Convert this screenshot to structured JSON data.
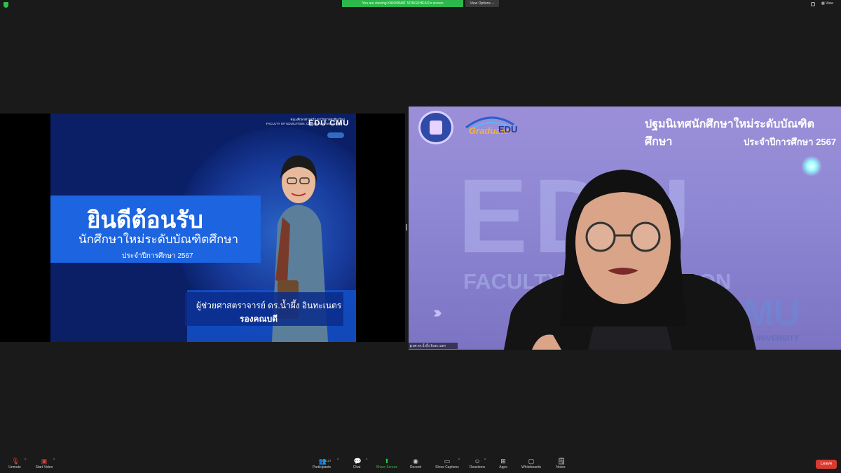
{
  "top": {
    "banner": "You are viewing KANYANAT SONGKHEAO's screen",
    "view_options": "View Options",
    "view": "View"
  },
  "slide": {
    "header_line1": "คณะศึกษาศาสตร์ มหาวิทยาลัยเชียงใหม่",
    "header_line2": "FACULTY OF EDUCATION, CHIANG MAI UNIVERSITY",
    "brand": "EDU CMU",
    "welcome": "ยินดีต้อนรับ",
    "subtitle": "นักศึกษาใหม่ระดับบัณฑิตศึกษา",
    "year": "ประจำปีการศึกษา  2567",
    "name": "ผู้ช่วยศาสตราจารย์  ดร.น้ำผึ้ง  อินทะเนตร",
    "position": "รองคณบดี"
  },
  "camera": {
    "title1": "ปฐมนิเทศนักศึกษาใหม่ระดับบัณฑิตศึกษา",
    "title2": "ประจำปีการศึกษา 2567",
    "logo_text_a": "Graduate",
    "logo_text_b": "EDU",
    "bg_big": "EDU",
    "bg_faculty": "FACULTY OF EDUCATION",
    "bg_cmu": "CMU",
    "bg_uni": "MAI UNIVERSITY",
    "participant_name": "ผศ.ดร.น้ำผึ้ง อินทะเนตร"
  },
  "toolbar": {
    "unmute": "Unmute",
    "start_video": "Start Video",
    "participants": "Participants",
    "participants_count": "127",
    "chat": "Chat",
    "share_screen": "Share Screen",
    "record": "Record",
    "show_captions": "Show Captions",
    "reactions": "Reactions",
    "apps": "Apps",
    "whiteboards": "Whiteboards",
    "notes": "Notes",
    "leave": "Leave"
  },
  "colors": {
    "banner_green": "#2db84c",
    "slide_blue": "#1c64e0",
    "leave_red": "#d93a2f"
  }
}
